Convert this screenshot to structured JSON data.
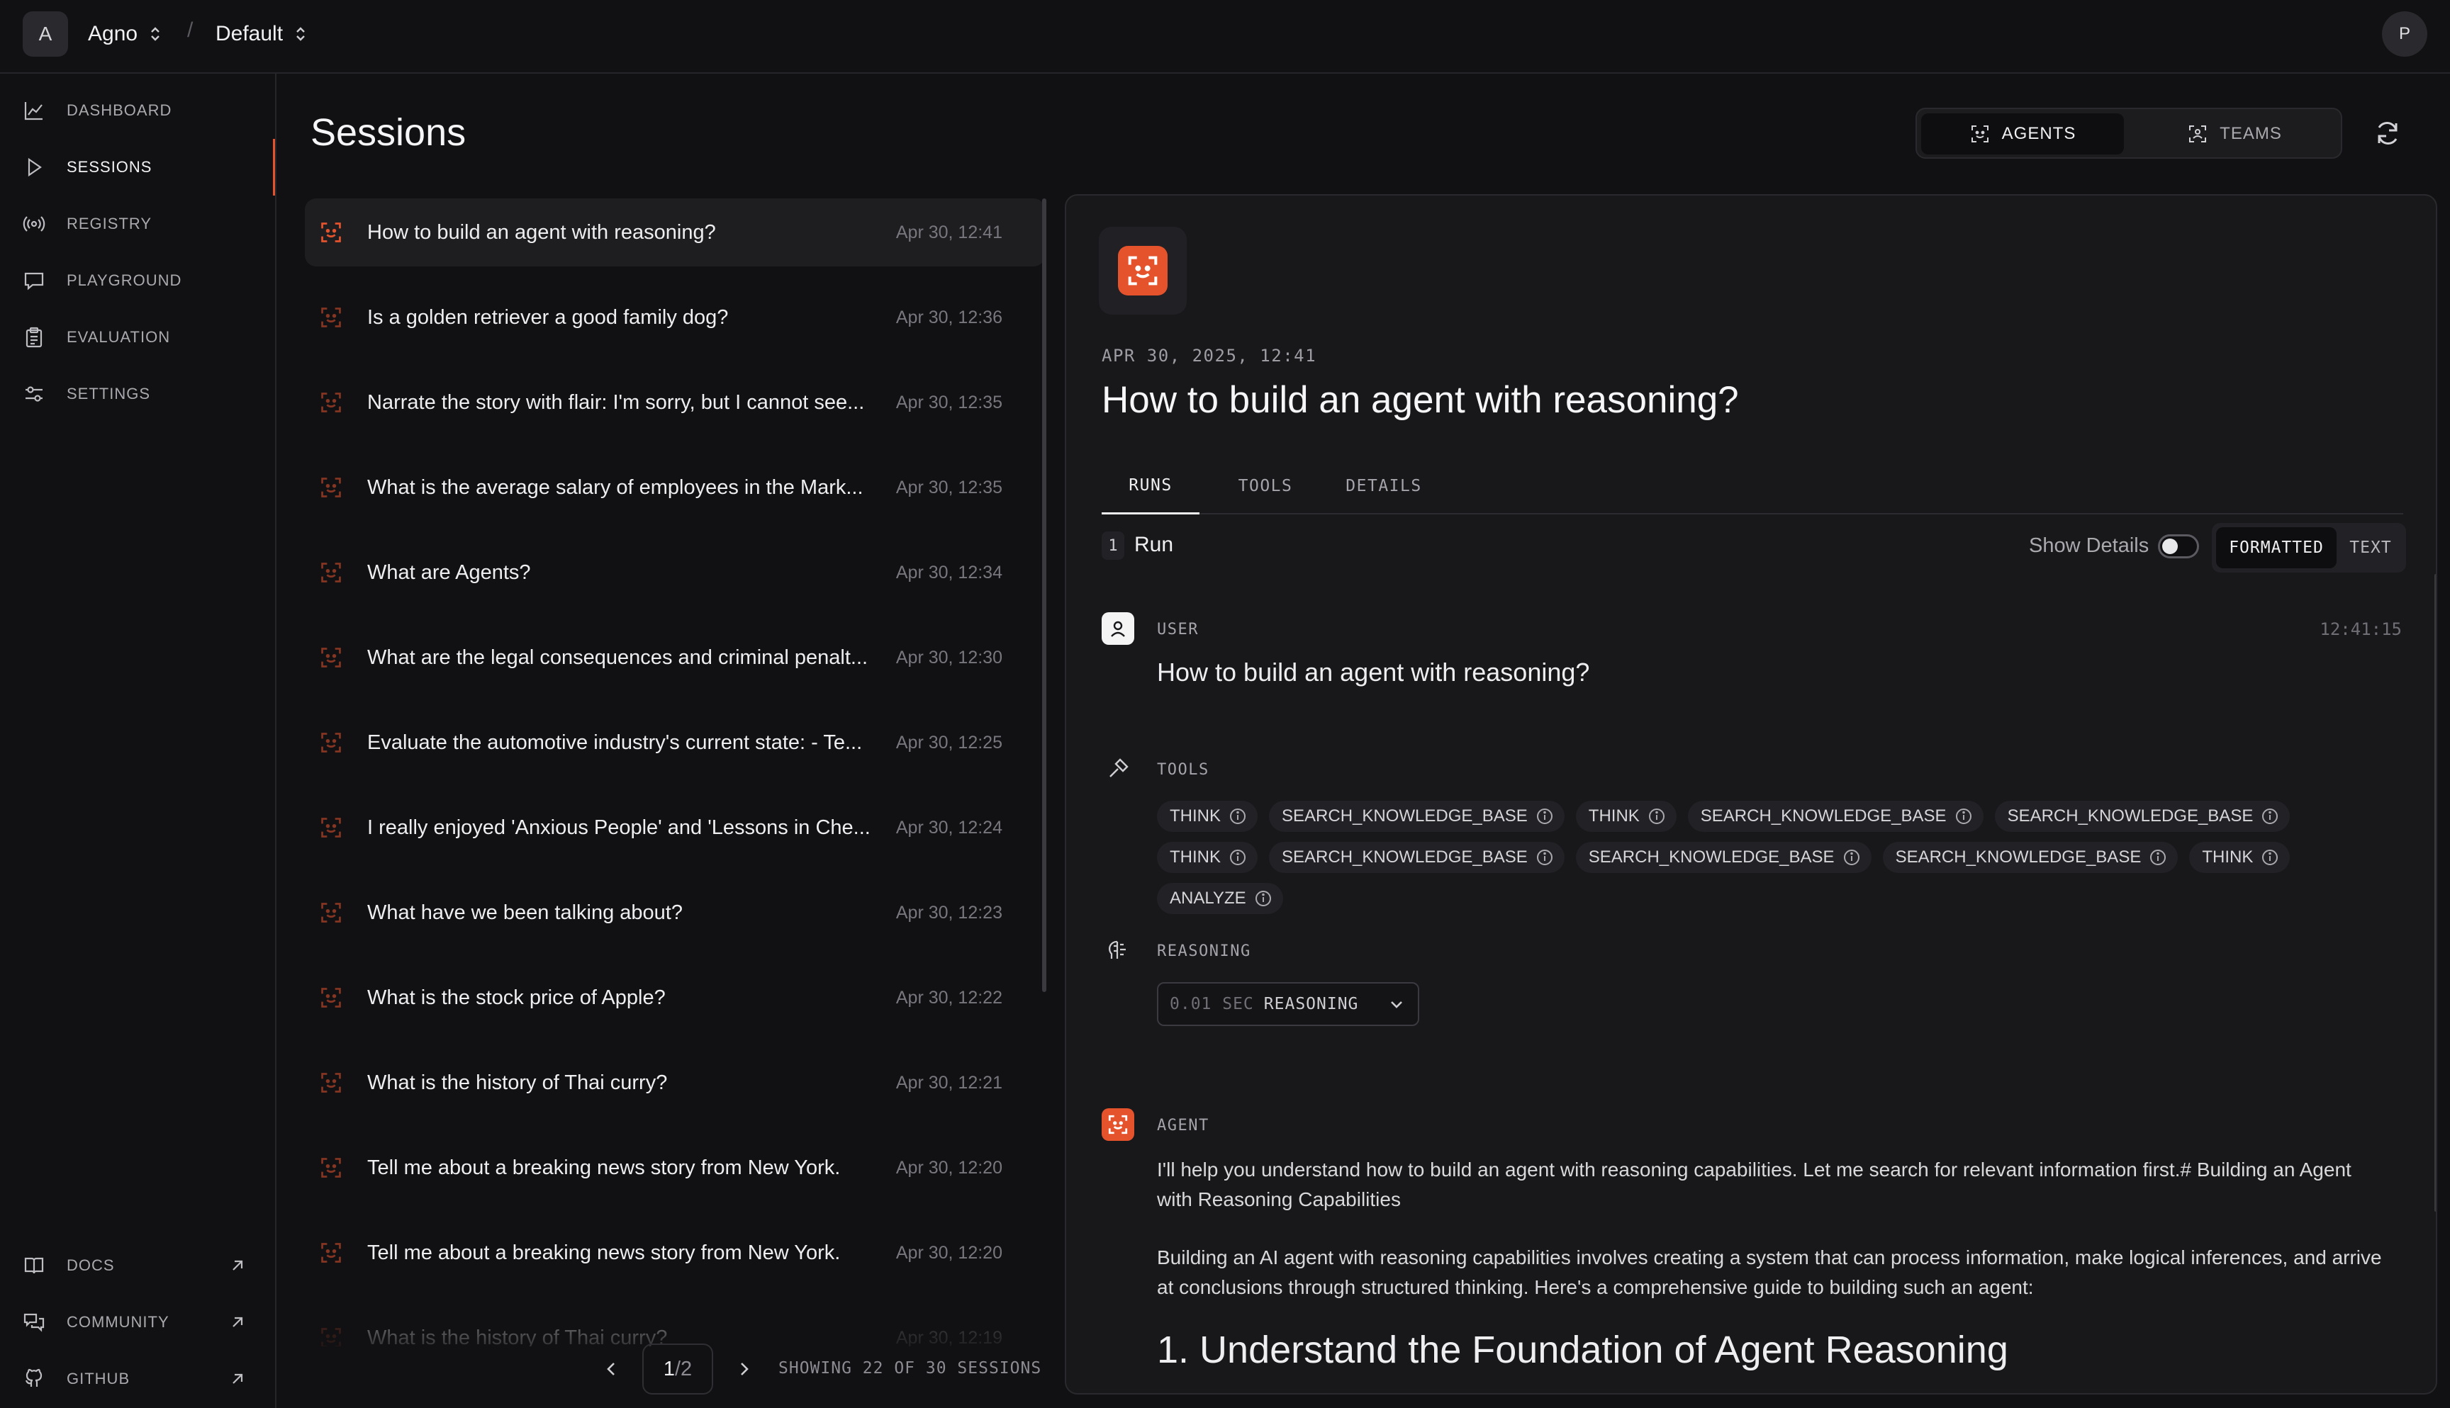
{
  "topbar": {
    "org_initial": "A",
    "org_name": "Agno",
    "environment": "Default",
    "separator": "/",
    "user_initial": "P"
  },
  "sidebar": {
    "items": [
      {
        "label": "DASHBOARD",
        "icon": "chart-line-icon"
      },
      {
        "label": "SESSIONS",
        "icon": "play-icon",
        "active": true
      },
      {
        "label": "REGISTRY",
        "icon": "broadcast-icon"
      },
      {
        "label": "PLAYGROUND",
        "icon": "chat-icon"
      },
      {
        "label": "EVALUATION",
        "icon": "clipboard-icon"
      },
      {
        "label": "SETTINGS",
        "icon": "sliders-icon"
      }
    ],
    "bottom_links": [
      {
        "label": "DOCS",
        "icon": "book-icon"
      },
      {
        "label": "COMMUNITY",
        "icon": "chat-bubbles-icon"
      },
      {
        "label": "GITHUB",
        "icon": "github-icon"
      }
    ]
  },
  "page": {
    "title": "Sessions"
  },
  "view_toggle": {
    "agents": "AGENTS",
    "teams": "TEAMS"
  },
  "sessions": [
    {
      "title": "How to build an agent with reasoning?",
      "date": "Apr 30, 12:41"
    },
    {
      "title": "Is a golden retriever a good family dog?",
      "date": "Apr 30, 12:36"
    },
    {
      "title": "Narrate the story with flair: I'm sorry, but I cannot see...",
      "date": "Apr 30, 12:35"
    },
    {
      "title": "What is the average salary of employees in the Mark...",
      "date": "Apr 30, 12:35"
    },
    {
      "title": "What are Agents?",
      "date": "Apr 30, 12:34"
    },
    {
      "title": "What are the legal consequences and criminal penalt...",
      "date": "Apr 30, 12:30"
    },
    {
      "title": "Evaluate the automotive industry's current state: - Te...",
      "date": "Apr 30, 12:25"
    },
    {
      "title": "I really enjoyed 'Anxious People' and 'Lessons in Che...",
      "date": "Apr 30, 12:24"
    },
    {
      "title": "What have we been talking about?",
      "date": "Apr 30, 12:23"
    },
    {
      "title": "What is the stock price of Apple?",
      "date": "Apr 30, 12:22"
    },
    {
      "title": "What is the history of Thai curry?",
      "date": "Apr 30, 12:21"
    },
    {
      "title": "Tell me about a breaking news story from New York.",
      "date": "Apr 30, 12:20"
    },
    {
      "title": "Tell me about a breaking news story from New York.",
      "date": "Apr 30, 12:20"
    },
    {
      "title": "What is the history of Thai curry?",
      "date": "Apr 30, 12:19"
    }
  ],
  "pagination": {
    "page": "1",
    "total": "/2",
    "showing": "SHOWING 22 OF 30 SESSIONS"
  },
  "detail": {
    "date": "APR 30, 2025, 12:41",
    "title": "How to build an agent with reasoning?",
    "tabs": [
      "RUNS",
      "TOOLS",
      "DETAILS"
    ],
    "run_number": "1",
    "run_label": "Run",
    "show_details": "Show Details",
    "format_formatted": "FORMATTED",
    "format_text": "TEXT",
    "user_label": "USER",
    "user_time": "12:41:15",
    "user_message": "How to build an agent with reasoning?",
    "tools_label": "TOOLS",
    "tools": [
      "THINK",
      "SEARCH_KNOWLEDGE_BASE",
      "THINK",
      "SEARCH_KNOWLEDGE_BASE",
      "SEARCH_KNOWLEDGE_BASE",
      "THINK",
      "SEARCH_KNOWLEDGE_BASE",
      "SEARCH_KNOWLEDGE_BASE",
      "SEARCH_KNOWLEDGE_BASE",
      "THINK",
      "ANALYZE"
    ],
    "reasoning_label": "REASONING",
    "reasoning_time": "0.01 SEC",
    "reasoning_dropdown": "REASONING",
    "agent_label": "AGENT",
    "agent_para1": "I'll help you understand how to build an agent with reasoning capabilities. Let me search for relevant information first.# Building an Agent with Reasoning Capabilities",
    "agent_para2": "Building an AI agent with reasoning capabilities involves creating a system that can process information, make logical inferences, and arrive at conclusions through structured thinking. Here's a comprehensive guide to building such an agent:",
    "agent_heading": "1. Understand the Foundation of Agent Reasoning"
  },
  "colors": {
    "accent": "#e5532d",
    "background": "#111113",
    "panel": "#18181b"
  }
}
